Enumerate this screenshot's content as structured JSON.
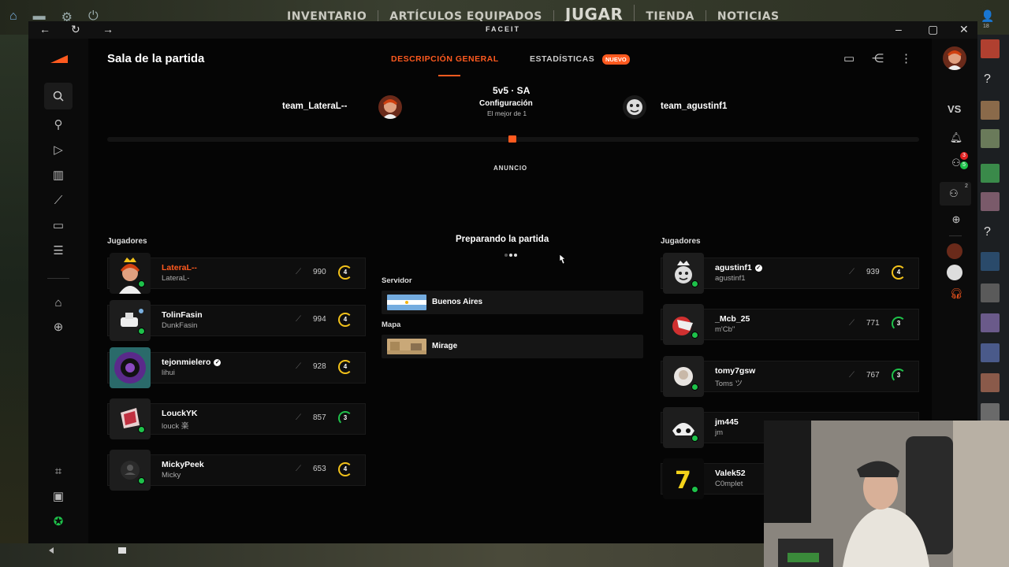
{
  "game_menu": {
    "items": [
      "INVENTARIO",
      "ARTÍCULOS EQUIPADOS",
      "JUGAR",
      "TIENDA",
      "NOTICIAS"
    ]
  },
  "titlebar": {
    "logo": "FACEIT",
    "controls": [
      "minimize-icon",
      "maximize-icon",
      "close-icon"
    ]
  },
  "sidebar": {
    "icons": [
      "faceit-logo-icon",
      "search-icon",
      "find-players-icon",
      "play-icon",
      "leaderboard-icon",
      "stats-icon",
      "video-icon",
      "list-icon",
      "clubs-icon",
      "add-icon",
      "screenshot-icon",
      "store-icon",
      "premium-icon"
    ]
  },
  "header": {
    "title": "Sala de la partida",
    "tabs": [
      {
        "label": "DESCRIPCIÓN GENERAL",
        "active": true
      },
      {
        "label": "ESTADÍSTICAS",
        "badge": "NUEVO",
        "active": false
      }
    ],
    "accent_color": "#ff5a1f"
  },
  "match": {
    "team1": "team_LateraL--",
    "team2": "team_agustinf1",
    "format": "5v5 · SA",
    "config_label": "Configuración",
    "best_of": "El mejor de 1",
    "announcement": "ANUNCIO",
    "status": "Preparando la partida",
    "server_label": "Servidor",
    "server": "Buenos Aires",
    "map_label": "Mapa",
    "map": "Mirage"
  },
  "team1_players_label": "Jugadores",
  "team2_players_label": "Jugadores",
  "team1_players": [
    {
      "nick": "LateraL--",
      "name": "LateraL-",
      "elo": "990",
      "level": "4",
      "me": true
    },
    {
      "nick": "TolinFasin",
      "name": "DunkFasin",
      "elo": "994",
      "level": "4"
    },
    {
      "nick": "tejonmielero",
      "name": "lihui",
      "elo": "928",
      "level": "4",
      "verified": true
    },
    {
      "nick": "LouckYK",
      "name": "louck 楽",
      "elo": "857",
      "level": "3"
    },
    {
      "nick": "MickyPeek",
      "name": "Micky",
      "elo": "653",
      "level": "4"
    }
  ],
  "team2_players": [
    {
      "nick": "agustinf1",
      "name": "agustinf1",
      "elo": "939",
      "level": "4",
      "verified": true
    },
    {
      "nick": "_Mcb_25",
      "name": "m'Cb\"",
      "elo": "771",
      "level": "3"
    },
    {
      "nick": "tomy7gsw",
      "name": "Toms ツ",
      "elo": "767",
      "level": "3"
    },
    {
      "nick": "jm445",
      "name": "jm",
      "elo": "",
      "level": ""
    },
    {
      "nick": "Valek52",
      "name": "C0mplet",
      "elo": "",
      "level": ""
    }
  ],
  "rightbar": {
    "vs_label": "VS",
    "party_count": "3",
    "online_count": "5",
    "friends_count": "2"
  },
  "steam_friends_count": "18"
}
